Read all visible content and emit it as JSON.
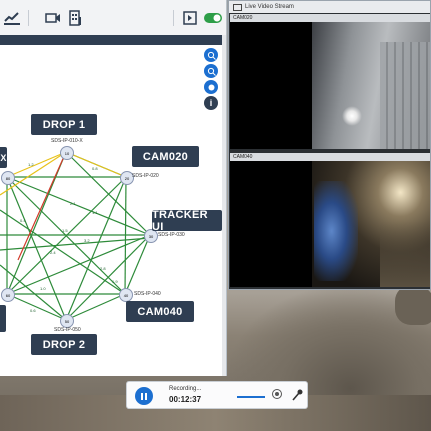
{
  "app": {
    "toolbar_icons": [
      "network-map-icon",
      "video-camera-icon",
      "building-icon",
      "panel-toggle-icon",
      "toggle-switch-icon"
    ]
  },
  "map": {
    "labels": {
      "drop1": "DROP 1",
      "cam020": "CAM020",
      "tracker": "TRACKER UI",
      "cam040": "CAM040",
      "drop2": "DROP 2",
      "left_top": "X"
    },
    "sublabels": {
      "drop1": "SDS-IP-010-X",
      "cam020": "SDS-IP-020",
      "tracker": "SDS-IP-030",
      "cam040": "SDS-IP-040",
      "drop2": "SDS-IP-050"
    },
    "nodes": [
      {
        "id": "n10",
        "text": "10"
      },
      {
        "id": "n20",
        "text": "20"
      },
      {
        "id": "n30",
        "text": "30"
      },
      {
        "id": "n40",
        "text": "40"
      },
      {
        "id": "n50",
        "text": "50"
      },
      {
        "id": "n60",
        "text": "60"
      },
      {
        "id": "n80",
        "text": "80"
      }
    ],
    "zoom_icons": [
      "zoom-in-icon",
      "zoom-out-icon",
      "zoom-fit-icon",
      "info-icon"
    ]
  },
  "video": {
    "title": "Live Video Stream",
    "panes": [
      "CAM020",
      "CAM040"
    ]
  },
  "recorder": {
    "status": "Recording...",
    "time": "00:12:37"
  },
  "colors": {
    "accent": "#1c6fd0",
    "label_bg": "#2f3e52",
    "link_green": "#2e8b3a",
    "link_yellow": "#e8c21a",
    "link_red": "#d23a2a"
  }
}
